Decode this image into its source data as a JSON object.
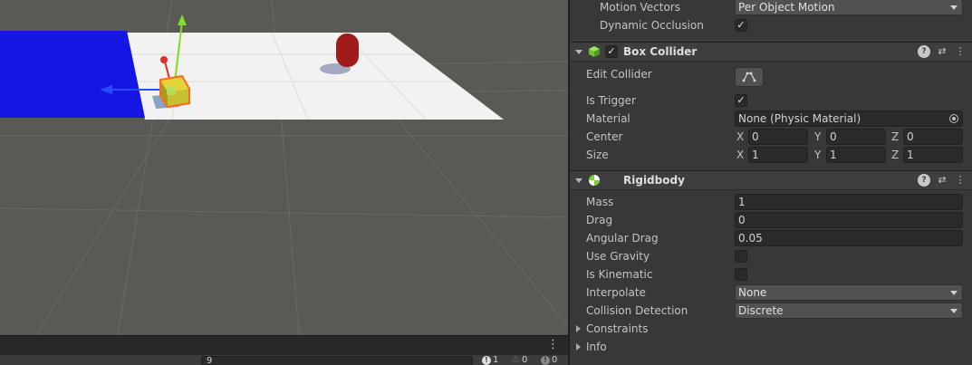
{
  "scene": {
    "colors": {
      "ground": "#5b5955",
      "plane": "#f4f4f4",
      "blue_plane": "#1414e6",
      "capsule": "#a11b1b",
      "gizmo_y": "#7fe024",
      "gizmo_x": "#e82a2a",
      "gizmo_z": "#2a4cff",
      "selected_cube": "#c8c830",
      "selection_outline": "#ff6a1a"
    }
  },
  "console": {
    "search_value": "9",
    "menu_icon": "⋮",
    "counts": [
      {
        "icon": "info-icon",
        "glyph": "!",
        "value": "1"
      },
      {
        "icon": "warning-icon",
        "glyph": "⚠",
        "value": "0"
      },
      {
        "icon": "error-icon",
        "glyph": "!",
        "value": "0"
      }
    ]
  },
  "inspector": {
    "renderer": {
      "motion_vectors_label": "Motion Vectors",
      "motion_vectors_value": "Per Object Motion",
      "dynamic_occlusion_label": "Dynamic Occlusion",
      "dynamic_occlusion_checked": "✓"
    },
    "box_collider": {
      "title": "Box Collider",
      "enabled_check": "✓",
      "edit_collider_label": "Edit Collider",
      "is_trigger_label": "Is Trigger",
      "is_trigger_checked": "✓",
      "material_label": "Material",
      "material_value": "None (Physic Material)",
      "center_label": "Center",
      "center": {
        "x_label": "X",
        "x": "0",
        "y_label": "Y",
        "y": "0",
        "z_label": "Z",
        "z": "0"
      },
      "size_label": "Size",
      "size": {
        "x_label": "X",
        "x": "1",
        "y_label": "Y",
        "y": "1",
        "z_label": "Z",
        "z": "1"
      }
    },
    "rigidbody": {
      "title": "Rigidbody",
      "mass_label": "Mass",
      "mass": "1",
      "drag_label": "Drag",
      "drag": "0",
      "angular_drag_label": "Angular Drag",
      "angular_drag": "0.05",
      "use_gravity_label": "Use Gravity",
      "is_kinematic_label": "Is Kinematic",
      "interpolate_label": "Interpolate",
      "interpolate": "None",
      "collision_detection_label": "Collision Detection",
      "collision_detection": "Discrete",
      "constraints_label": "Constraints",
      "info_label": "Info"
    },
    "header_tools": {
      "help": "?",
      "presets": "⇄",
      "menu": "⋮"
    }
  }
}
